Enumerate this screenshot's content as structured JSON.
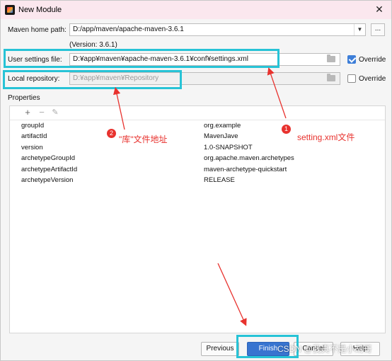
{
  "window": {
    "title": "New Module",
    "close_glyph": "✕"
  },
  "maven_home": {
    "label": "Maven home path:",
    "value": "D:/app/maven/apache-maven-3.6.1",
    "browse_label": "...",
    "version_note": "(Version: 3.6.1)"
  },
  "user_settings": {
    "label": "User settings file:",
    "value": "D:¥app¥maven¥apache-maven-3.6.1¥conf¥settings.xml",
    "override_label": "Override",
    "override_checked": true
  },
  "local_repository": {
    "label": "Local repository:",
    "value": "D:¥app¥maven¥Repository",
    "override_label": "Override",
    "override_checked": false
  },
  "properties": {
    "heading": "Properties",
    "toolbar": {
      "add": "+",
      "remove": "−",
      "edit": "✎"
    },
    "rows": [
      {
        "key": "groupId",
        "value": "org.example"
      },
      {
        "key": "artifactId",
        "value": "MavenJave"
      },
      {
        "key": "version",
        "value": "1.0-SNAPSHOT"
      },
      {
        "key": "archetypeGroupId",
        "value": "org.apache.maven.archetypes"
      },
      {
        "key": "archetypeArtifactId",
        "value": "maven-archetype-quickstart"
      },
      {
        "key": "archetypeVersion",
        "value": "RELEASE"
      }
    ]
  },
  "annotations": {
    "note1_number": "1",
    "note1_text": "setting.xml文件",
    "note2_number": "2",
    "note2_text": "\"库\"文件地址",
    "color": "#e8322e",
    "highlight_color": "#27c3d6"
  },
  "footer": {
    "previous": "Previous",
    "finish": "Finish",
    "cancel": "Cancel",
    "help": "Help",
    "watermark": "CSDN @我真不是小胡哥"
  }
}
